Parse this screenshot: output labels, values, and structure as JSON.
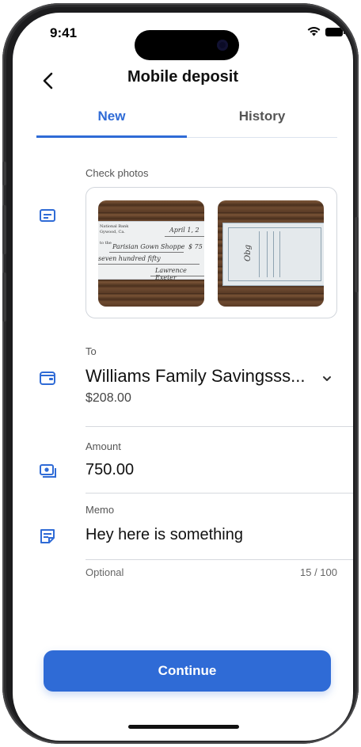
{
  "status_bar": {
    "time": "9:41"
  },
  "nav": {
    "title": "Mobile deposit"
  },
  "tabs": [
    {
      "label": "New",
      "active": true
    },
    {
      "label": "History",
      "active": false
    }
  ],
  "check_photos": {
    "label": "Check photos",
    "front": {
      "bank": "National Bank",
      "location": "Gywood, Ca.",
      "date": "April 1, 2",
      "payee_prefix": "to the",
      "payee": "Parisian Gown Shoppe",
      "amount": "$ 75",
      "amount_words": "seven hundred fifty",
      "signature": "Lawrence Exeter"
    },
    "back": {
      "endorsement": "Obg"
    }
  },
  "to": {
    "label": "To",
    "account": "Williams Family Savingsss...",
    "balance": "$208.00"
  },
  "amount": {
    "label": "Amount",
    "value": "750.00"
  },
  "memo": {
    "label": "Memo",
    "value": "Hey here is something",
    "helper": "Optional",
    "counter": "15 / 100"
  },
  "continue_label": "Continue",
  "colors": {
    "accent": "#2f6bd6",
    "text": "#111111",
    "muted": "#555555"
  },
  "icons": {
    "back": "chevron-left-icon",
    "check": "check-card-icon",
    "to": "wallet-icon",
    "amount": "cash-icon",
    "memo": "note-icon",
    "dropdown": "chevron-down-icon"
  }
}
